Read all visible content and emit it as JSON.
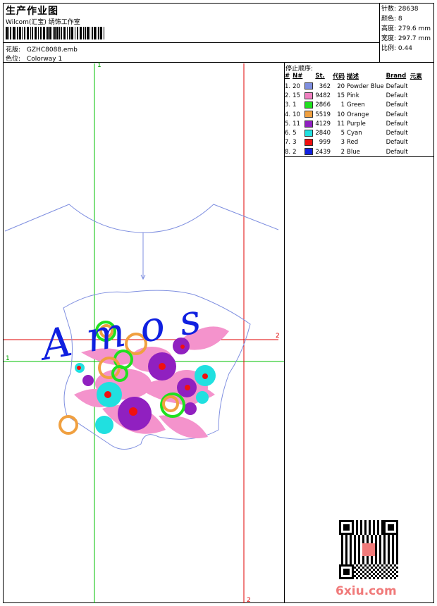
{
  "header": {
    "title": "生产作业图",
    "company": "Wilcom(汇宝) 绣饰工作室",
    "design_label": "花版:",
    "design_value": "GZHC8088.emb",
    "colorway_label": "色位:",
    "colorway_value": "Colorway 1"
  },
  "stats": {
    "stitches": "针数: 28638",
    "colors": "颜色: 8",
    "height": "高度: 279.6 mm",
    "width": "宽度: 297.7 mm",
    "scale": "比例: 0.44"
  },
  "stop_sequence": {
    "title": "停止顺序:",
    "headers": [
      "#",
      "N#",
      "St.",
      "代码",
      "描述",
      "Brand",
      "元素"
    ],
    "rows": [
      {
        "idx": "1.",
        "n": "20",
        "color": "#7f8fe0",
        "st": "362",
        "code": "20",
        "desc": "Powder Blue",
        "brand": "Default"
      },
      {
        "idx": "2.",
        "n": "15",
        "color": "#f080c0",
        "st": "9482",
        "code": "15",
        "desc": "Pink",
        "brand": "Default"
      },
      {
        "idx": "3.",
        "n": "1",
        "color": "#20e020",
        "st": "2866",
        "code": "1",
        "desc": "Green",
        "brand": "Default"
      },
      {
        "idx": "4.",
        "n": "10",
        "color": "#f0a040",
        "st": "5519",
        "code": "10",
        "desc": "Orange",
        "brand": "Default"
      },
      {
        "idx": "5.",
        "n": "11",
        "color": "#9020c0",
        "st": "4129",
        "code": "11",
        "desc": "Purple",
        "brand": "Default"
      },
      {
        "idx": "6.",
        "n": "5",
        "color": "#20e0e0",
        "st": "2840",
        "code": "5",
        "desc": "Cyan",
        "brand": "Default"
      },
      {
        "idx": "7.",
        "n": "3",
        "color": "#f01010",
        "st": "999",
        "code": "3",
        "desc": "Red",
        "brand": "Default"
      },
      {
        "idx": "8.",
        "n": "2",
        "color": "#1020e0",
        "st": "2439",
        "code": "2",
        "desc": "Blue",
        "brand": "Default"
      }
    ]
  },
  "canvas": {
    "axis_labels": {
      "top_1": "1",
      "left_1": "1",
      "right_2": "2",
      "bottom_2": "2"
    },
    "lettering": "Amos"
  },
  "watermark": "6xiu.com"
}
